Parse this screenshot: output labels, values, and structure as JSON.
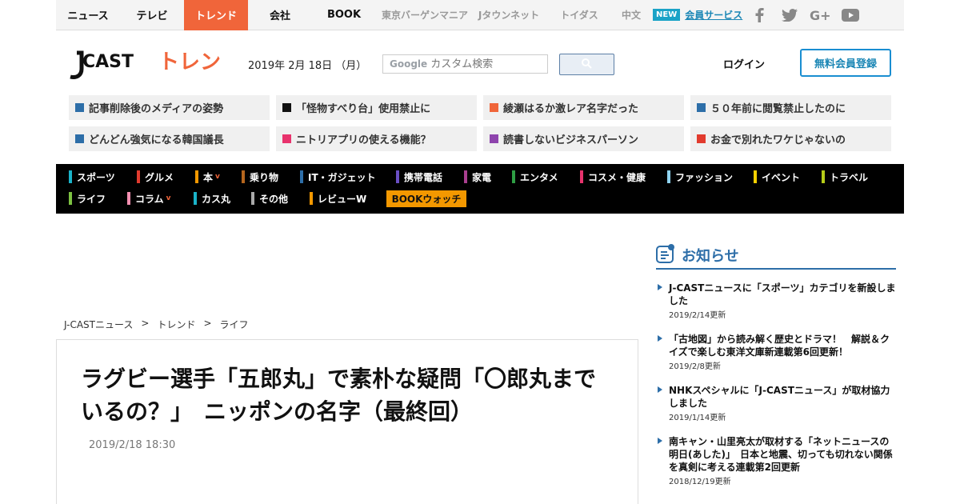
{
  "topnav": {
    "items": [
      "ニュース",
      "テレビ",
      "トレンド",
      "会社",
      "BOOK"
    ],
    "sub_items": [
      "東京バーゲンマニア",
      "Jタウンネット",
      "トイダス",
      "中文"
    ],
    "new_badge": "NEW",
    "member_service": "会員サービス",
    "social_icons": [
      "facebook-icon",
      "twitter-icon",
      "google-plus-icon",
      "youtube-icon"
    ]
  },
  "header": {
    "date": "2019年 2月 18日 （月）",
    "search_brand": "Google",
    "search_placeholder": "カスタム検索",
    "login": "ログイン",
    "register": "無料会員登録"
  },
  "headlines": [
    {
      "text": "記事削除後のメディアの姿勢",
      "color": "#2d6ea8"
    },
    {
      "text": "「怪物すべり台」使用禁止に",
      "color": "#111111"
    },
    {
      "text": "綾瀬はるか激レア名字だった",
      "color": "#f0653a"
    },
    {
      "text": "５０年前に閲覧禁止したのに",
      "color": "#2d6ea8"
    },
    {
      "text": "どんどん強気になる韓国議長",
      "color": "#2d6ea8"
    },
    {
      "text": "ニトリアプリの使える機能？",
      "color": "#e8336d"
    },
    {
      "text": "読書しないビジネスパーソン",
      "color": "#8e44ad"
    },
    {
      "text": "お金で別れたワケじゃないの",
      "color": "#e23b2e"
    }
  ],
  "categories": [
    {
      "label": "スポーツ",
      "color": "#1ab3c9"
    },
    {
      "label": "グルメ",
      "color": "#e23b2e"
    },
    {
      "label": "本",
      "color": "#f39800",
      "caret": "v"
    },
    {
      "label": "乗り物",
      "color": "#b5651d"
    },
    {
      "label": "IT・ガジェット",
      "color": "#2d6ea8"
    },
    {
      "label": "携帯電話",
      "color": "#6a4fc4"
    },
    {
      "label": "家電",
      "color": "#a93f8f"
    },
    {
      "label": "エンタメ",
      "color": "#2e9e44"
    },
    {
      "label": "コスメ・健康",
      "color": "#e8336d"
    },
    {
      "label": "ファッション",
      "color": "#8fd3f0"
    },
    {
      "label": "イベント",
      "color": "#f5d000"
    },
    {
      "label": "トラベル",
      "color": "#b5cc18"
    },
    {
      "label": "ライフ",
      "color": "#7dc242"
    },
    {
      "label": "コラム",
      "color": "#f48fb1",
      "caret": "v"
    },
    {
      "label": "カス丸",
      "color": "#1ab3c9"
    },
    {
      "label": "その他",
      "color": "#aaaaaa"
    },
    {
      "label": "レビューW",
      "color": "#f39800"
    }
  ],
  "bookwatch": "BOOKウォッチ",
  "breadcrumb": [
    "J-CASTニュース",
    ">",
    "トレンド",
    ">",
    "ライフ"
  ],
  "article": {
    "title": "ラグビー選手「五郎丸」で素朴な疑問「〇郎丸までいるの？」　ニッポンの名字（最終回）",
    "date": "2019/2/18 18:30"
  },
  "sidebar": {
    "title": "お知らせ",
    "news": [
      {
        "text": "J-CASTニュースに「スポーツ」カテゴリを新設しました",
        "updated": "2019/2/14更新"
      },
      {
        "text": "「古地図」から読み解く歴史とドラマ！　解説＆クイズで楽しむ東洋文庫新連載第6回更新！",
        "updated": "2019/2/8更新"
      },
      {
        "text": "NHKスペシャルに「J-CASTニュース」が取材協力しました",
        "updated": "2019/1/14更新"
      },
      {
        "text": "南キャン・山里亮太が取材する「ネットニュースの明日(あした)」　日本と地震、切っても切れない関係を真剣に考える連載第2回更新",
        "updated": "2018/12/19更新"
      }
    ]
  },
  "colors": {
    "accent": "#f0653a",
    "brand_blue": "#2d6ea8"
  }
}
